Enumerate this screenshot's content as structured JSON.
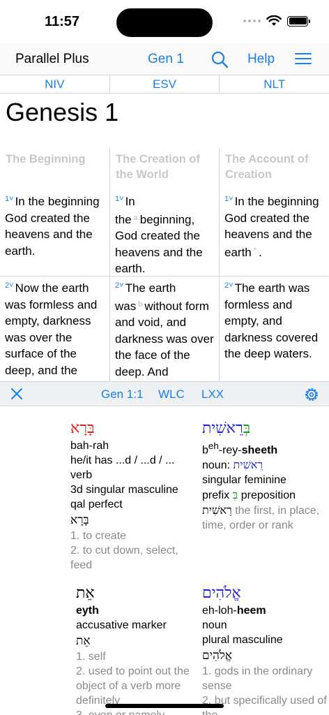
{
  "status": {
    "time": "11:57"
  },
  "nav": {
    "title": "Parallel Plus",
    "chapter": "Gen 1",
    "help": "Help"
  },
  "versions": [
    "NIV",
    "ESV",
    "NLT"
  ],
  "chapter_title": "Genesis 1",
  "columns": [
    {
      "heading": "The Beginning",
      "v1_num": "1",
      "v1_text": "In the beginning God created the heavens and the earth.",
      "v2_num": "2",
      "v2_text": "Now the earth was formless and empty, darkness was over the surface of the deep, and the"
    },
    {
      "heading": "The Creation of the World",
      "v1_num": "1",
      "v1_pre": "In the",
      "v1_fn": "a",
      "v1_text": "beginning, God created the heavens and the earth.",
      "v2_num": "2",
      "v2_pre": "The earth was",
      "v2_fn": "b",
      "v2_text": "without form and void, and darkness was over the face of the deep. And"
    },
    {
      "heading": "The Account of Creation",
      "v1_num": "1",
      "v1_text": "In the beginning God created the heavens and the earth",
      "v1_fn": "*",
      "v1_end": ".",
      "v2_num": "2",
      "v2_text": "The earth was formless and empty, and darkness covered the deep waters."
    }
  ],
  "panel": {
    "ref": "Gen 1:1",
    "wlc": "WLC",
    "lxx": "LXX"
  },
  "words": [
    {
      "hebrew": "בָּרָא",
      "translit": "bah-rah",
      "gloss": [
        "he/it has ...d / ...d / ...",
        "verb",
        "3d singular masculine",
        "qal perfect"
      ],
      "lemma": "בָּרָא",
      "defs": [
        "1. to create",
        "2. to cut down, select, feed"
      ]
    },
    {
      "hebrew_prefix": "בְּ",
      "hebrew_main": "רֵאשִׁית",
      "translit_pre": "b",
      "translit_sup": "eh",
      "translit_mid": "-rey-",
      "translit_bold": "sheeth",
      "pos_label": "noun: ",
      "pos_hebrew": "רֵאשִׁית",
      "line2": "singular feminine",
      "prefix_label": "prefix ",
      "prefix_hebrew": "בְּ",
      "prefix_after": " preposition",
      "lemma": "רֵאשִׁית",
      "lemma_def": " the first, in place, time, order or rank"
    },
    {
      "hebrew": "אֵת",
      "translit": "eyth",
      "gloss": [
        "accusative marker"
      ],
      "lemma": "אֵת",
      "defs": [
        "1. self",
        "2. used to point out the object of a verb more definitely",
        "3. even or namely"
      ]
    },
    {
      "hebrew": "אֱלֹהִים",
      "translit": "eh-loh-",
      "translit_bold": "heem",
      "gloss": [
        "noun",
        "plural masculine"
      ],
      "lemma": "אֱלֹהִים",
      "defs": [
        "1. gods in the ordinary sense",
        "2. but specifically used of the"
      ]
    }
  ]
}
